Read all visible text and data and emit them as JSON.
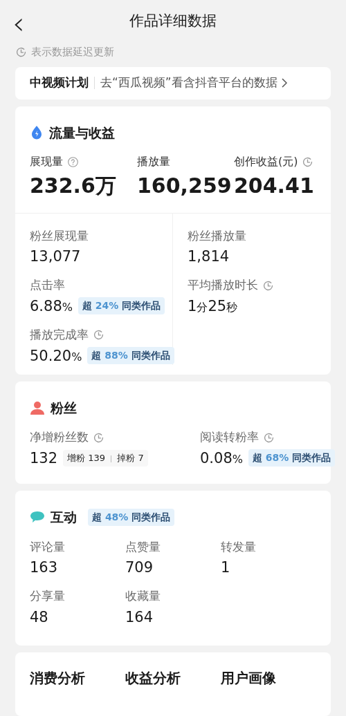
{
  "header": {
    "back": "‹",
    "title": "作品详细数据"
  },
  "delay_note": "表示数据延迟更新",
  "program_card": {
    "name": "中视频计划",
    "link": "去“西瓜视频”看含抖音平台的数据"
  },
  "flow": {
    "title": "流量与收益",
    "top_metrics": [
      {
        "label": "展现量",
        "value": "232.6",
        "unit": "万",
        "help": true,
        "delayed": false
      },
      {
        "label": "播放量",
        "value": "160,259",
        "help": false,
        "delayed": false
      },
      {
        "label": "创作收益(元)",
        "value": "204.41",
        "help": false,
        "delayed": true
      }
    ],
    "left_metrics": [
      {
        "label": "粉丝展现量",
        "value": "13,077",
        "delayed": false
      },
      {
        "label": "点击率",
        "value": "6.88",
        "unit": "%",
        "delayed": false,
        "badge": {
          "prefix": "超",
          "percent": "24%",
          "suffix": "同类作品"
        }
      },
      {
        "label": "播放完成率",
        "value": "50.20",
        "unit": "%",
        "delayed": true,
        "badge": {
          "prefix": "超",
          "percent": "88%",
          "suffix": "同类作品"
        }
      }
    ],
    "right_metrics": [
      {
        "label": "粉丝播放量",
        "value": "1,814",
        "delayed": false
      },
      {
        "label": "平均播放时长",
        "value": "1",
        "unit": "分",
        "value2": "25",
        "unit2": "秒",
        "delayed": true
      }
    ]
  },
  "fans": {
    "title": "粉丝",
    "net": {
      "label": "净增粉丝数",
      "value": "132",
      "delayed": true,
      "gain": {
        "label": "增粉",
        "value": "139"
      },
      "loss": {
        "label": "掉粉",
        "value": "7"
      }
    },
    "rate": {
      "label": "阅读转粉率",
      "value": "0.08",
      "unit": "%",
      "delayed": true,
      "badge": {
        "prefix": "超",
        "percent": "68%",
        "suffix": "同类作品"
      }
    }
  },
  "interaction": {
    "title": "互动",
    "badge": {
      "prefix": "超",
      "percent": "48%",
      "suffix": "同类作品"
    },
    "metrics": [
      {
        "label": "评论量",
        "value": "163"
      },
      {
        "label": "点赞量",
        "value": "709"
      },
      {
        "label": "转发量",
        "value": "1"
      },
      {
        "label": "分享量",
        "value": "48"
      },
      {
        "label": "收藏量",
        "value": "164"
      }
    ]
  },
  "analysis_tabs": [
    "消费分析",
    "收益分析",
    "用户画像"
  ]
}
